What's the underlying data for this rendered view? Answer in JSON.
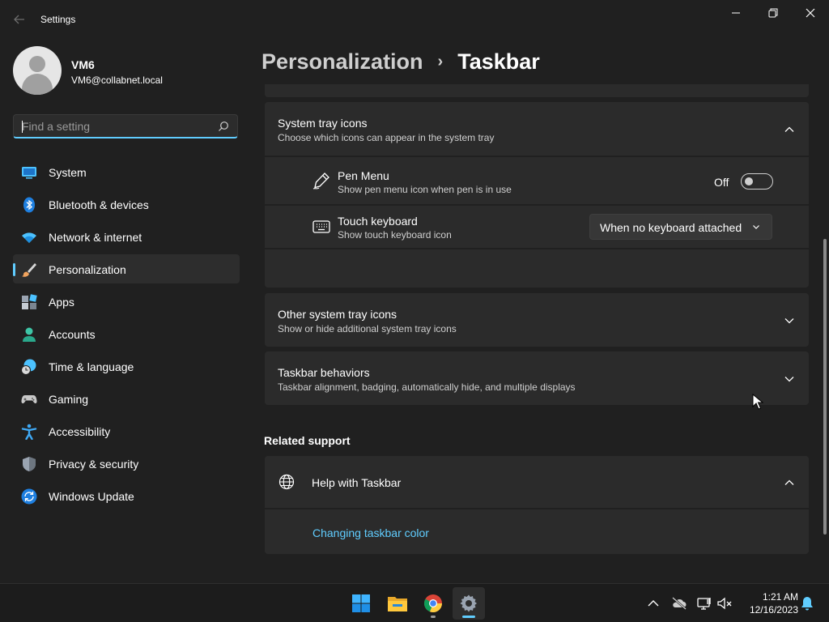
{
  "window": {
    "app_title": "Settings",
    "minimize": "—",
    "maximize": "❐",
    "close": "✕"
  },
  "user": {
    "name": "VM6",
    "email": "VM6@collabnet.local"
  },
  "search": {
    "placeholder": "Find a setting",
    "value": ""
  },
  "sidebar": {
    "items": [
      {
        "label": "System",
        "icon": "system-icon",
        "color": "#4cc2ff"
      },
      {
        "label": "Bluetooth & devices",
        "icon": "bluetooth-icon",
        "color": "#1e90ff"
      },
      {
        "label": "Network & internet",
        "icon": "wifi-icon",
        "color": "#4cc2ff"
      },
      {
        "label": "Personalization",
        "icon": "brush-icon",
        "color": "#f0a35e",
        "selected": true
      },
      {
        "label": "Apps",
        "icon": "apps-icon",
        "color": "#9aa4b1"
      },
      {
        "label": "Accounts",
        "icon": "accounts-icon",
        "color": "#3ec5a6"
      },
      {
        "label": "Time & language",
        "icon": "globe-clock-icon",
        "color": "#4cc2ff"
      },
      {
        "label": "Gaming",
        "icon": "controller-icon",
        "color": "#c8c8c8"
      },
      {
        "label": "Accessibility",
        "icon": "accessibility-icon",
        "color": "#3fa9f5"
      },
      {
        "label": "Privacy & security",
        "icon": "shield-icon",
        "color": "#9aa4b1"
      },
      {
        "label": "Windows Update",
        "icon": "update-icon",
        "color": "#3fa9f5"
      }
    ]
  },
  "breadcrumb": {
    "parent": "Personalization",
    "separator": "›",
    "current": "Taskbar"
  },
  "system_tray": {
    "title": "System tray icons",
    "subtitle": "Choose which icons can appear in the system tray",
    "expanded": true,
    "rows": {
      "pen_menu": {
        "title": "Pen Menu",
        "subtitle": "Show pen menu icon when pen is in use",
        "toggle_label": "Off",
        "toggle_on": false
      },
      "touch_keyboard": {
        "title": "Touch keyboard",
        "subtitle": "Show touch keyboard icon",
        "dropdown_value": "When no keyboard attached"
      }
    }
  },
  "other_tray": {
    "title": "Other system tray icons",
    "subtitle": "Show or hide additional system tray icons",
    "expanded": false
  },
  "behaviors": {
    "title": "Taskbar behaviors",
    "subtitle": "Taskbar alignment, badging, automatically hide, and multiple displays",
    "expanded": false
  },
  "related_support": {
    "heading": "Related support",
    "help_title": "Help with Taskbar",
    "link": "Changing taskbar color"
  },
  "taskbar": {
    "apps": [
      "start-icon",
      "file-explorer-icon",
      "chrome-icon",
      "settings-icon"
    ],
    "active_app": "settings-icon",
    "time": "1:21 AM",
    "date": "12/16/2023"
  },
  "colors": {
    "accent": "#60cdff",
    "background": "#202020",
    "card": "#2b2b2b"
  }
}
